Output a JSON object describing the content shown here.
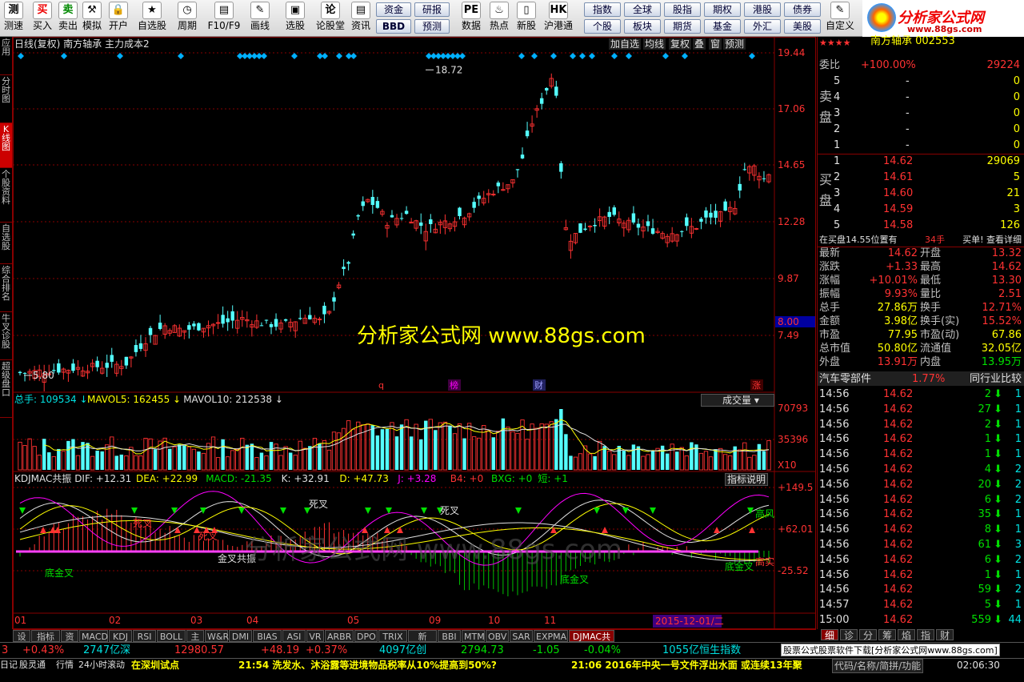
{
  "toolbar": {
    "buttons": [
      {
        "label": "测速",
        "icon": "测"
      },
      {
        "label": "买入",
        "icon": "买"
      },
      {
        "label": "卖出",
        "icon": "卖"
      },
      {
        "label": "模拟",
        "icon": "⚒"
      },
      {
        "label": "开户",
        "icon": "🔒"
      },
      {
        "label": "自选股",
        "icon": "★"
      },
      {
        "label": "周期",
        "icon": "◷"
      },
      {
        "label": "F10/F9",
        "icon": "▤"
      },
      {
        "label": "画线",
        "icon": "✎"
      },
      {
        "label": "选股",
        "icon": "▣"
      },
      {
        "label": "论股堂",
        "icon": "论"
      },
      {
        "label": "资讯",
        "icon": "▤"
      },
      {
        "label": "数据",
        "icon": "PE"
      },
      {
        "label": "热点",
        "icon": "♨"
      },
      {
        "label": "新股",
        "icon": "▯"
      },
      {
        "label": "沪港通",
        "icon": "HK"
      },
      {
        "label": "自定义",
        "icon": "✎"
      }
    ],
    "small_buttons": [
      "资金",
      "研报",
      "BBD",
      "预测",
      "指数",
      "全球",
      "股指",
      "期权",
      "港股",
      "债券",
      "个股",
      "板块",
      "期货",
      "基金",
      "外汇",
      "美股"
    ]
  },
  "logo": {
    "title": "分析家公式网",
    "url": "www.88gs.com"
  },
  "left_nav": [
    "应用",
    "分时图",
    "K线图",
    "个股资料",
    "自选股",
    "综合排名",
    "牛叉诊股",
    "超级盘口"
  ],
  "chart_header": {
    "title": "日线(复权)  南方轴承  主力成本2",
    "buttons": [
      "加自选",
      "均线",
      "复权",
      "叠",
      "窗",
      "预测"
    ],
    "price_labels": [
      "19.44",
      "17.06",
      "14.65",
      "12.28",
      "9.87",
      "8.00",
      "7.49"
    ],
    "max_label": "18.72",
    "min_label": "5.80",
    "watermark": "分析家公式网 www.88gs.com",
    "markers": [
      "q",
      "榜",
      "财",
      "涨"
    ],
    "watermark_dim": "分析家公式网 www.88gs.com"
  },
  "volume_header": {
    "items": [
      {
        "text": "总手: 109534",
        "color": "#00e0e0"
      },
      {
        "text": "MAVOL5: 162455",
        "color": "#ffff00"
      },
      {
        "text": "MAVOL10: 212538",
        "color": "#e0e0e0"
      }
    ],
    "dropdown": "成交量",
    "labels": [
      "70793",
      "35396",
      "X10"
    ]
  },
  "indicator_header": {
    "items": [
      {
        "text": "KDJMAC共振 DIF: +12.31",
        "color": "#e0e0e0"
      },
      {
        "text": "DEA: +22.99",
        "color": "#ffff00"
      },
      {
        "text": "MACD: -21.35",
        "color": "#00e000"
      },
      {
        "text": "K: +32.91",
        "color": "#e0e0e0"
      },
      {
        "text": "D: +47.73",
        "color": "#ffff00"
      },
      {
        "text": "J: +3.28",
        "color": "#ff00ff"
      },
      {
        "text": "B4: +0",
        "color": "#ff3232"
      },
      {
        "text": "BXG: +0",
        "color": "#00e000"
      },
      {
        "text": "短: +1",
        "color": "#00e000"
      }
    ],
    "explain_button": "指标说明",
    "labels": [
      "+149.5",
      "+62.01",
      "-25.52"
    ],
    "annotations": [
      "死叉",
      "死叉",
      "死叉",
      "死叉",
      "底金叉",
      "金叉共振",
      "底金叉",
      "底金叉",
      "高风",
      "高实"
    ]
  },
  "x_axis": {
    "months": [
      "01",
      "02",
      "03",
      "04",
      "05",
      "09",
      "10",
      "11"
    ],
    "current_date": "2015-12-01/二"
  },
  "tabs": [
    "设置",
    "指标平台",
    "资讯",
    "MACD",
    "KDJ",
    "RSI",
    "BOLL",
    "主力",
    "W&R",
    "DMI",
    "BIAS",
    "ASI",
    "VR",
    "ARBR",
    "DPO",
    "TRIX",
    "新DMA",
    "BBI",
    "MTM",
    "OBV",
    "SAR",
    "EXPMA",
    "DJMAC共振"
  ],
  "quote": {
    "header": "南方轴承 002553",
    "weibi": {
      "label": "委比",
      "pct": "+100.00%",
      "val": "29224"
    },
    "sell": [
      {
        "n": "5",
        "p": "-",
        "v": "0"
      },
      {
        "n": "4",
        "p": "-",
        "v": "0"
      },
      {
        "n": "3",
        "p": "-",
        "v": "0"
      },
      {
        "n": "2",
        "p": "-",
        "v": "0"
      },
      {
        "n": "1",
        "p": "-",
        "v": "0"
      }
    ],
    "sell_label": "卖盘",
    "buy": [
      {
        "n": "1",
        "p": "14.62",
        "v": "29069"
      },
      {
        "n": "2",
        "p": "14.61",
        "v": "5"
      },
      {
        "n": "3",
        "p": "14.60",
        "v": "21"
      },
      {
        "n": "4",
        "p": "14.59",
        "v": "3"
      },
      {
        "n": "5",
        "p": "14.58",
        "v": "126"
      }
    ],
    "buy_label": "买盘",
    "info_line": {
      "text": "在买盘14.55位置有",
      "qty": "34手",
      "btn": "买单! 查看详细"
    },
    "stats": [
      [
        "最新",
        "14.62",
        "开盘",
        "13.32"
      ],
      [
        "涨跌",
        "+1.33",
        "最高",
        "14.62"
      ],
      [
        "涨幅",
        "+10.01%",
        "最低",
        "13.30"
      ],
      [
        "振幅",
        "9.93%",
        "量比",
        "2.51"
      ],
      [
        "总手",
        "27.86万",
        "换手",
        "12.71%"
      ],
      [
        "金额",
        "3.98亿",
        "换手(实)",
        "15.52%"
      ],
      [
        "市盈",
        "77.95",
        "市盈(动)",
        "67.86"
      ],
      [
        "总市值",
        "50.80亿",
        "流通值",
        "32.05亿"
      ],
      [
        "外盘",
        "13.91万",
        "内盘",
        "13.95万"
      ]
    ],
    "industry": {
      "name": "汽车零部件",
      "pct": "1.77%",
      "btn": "同行业比较"
    },
    "ticks": [
      {
        "t": "14:56",
        "p": "14.62",
        "v": "2",
        "n": "1"
      },
      {
        "t": "14:56",
        "p": "14.62",
        "v": "27",
        "n": "1"
      },
      {
        "t": "14:56",
        "p": "14.62",
        "v": "2",
        "n": "1"
      },
      {
        "t": "14:56",
        "p": "14.62",
        "v": "1",
        "n": "1"
      },
      {
        "t": "14:56",
        "p": "14.62",
        "v": "1",
        "n": "1"
      },
      {
        "t": "14:56",
        "p": "14.62",
        "v": "4",
        "n": "2"
      },
      {
        "t": "14:56",
        "p": "14.62",
        "v": "20",
        "n": "2"
      },
      {
        "t": "14:56",
        "p": "14.62",
        "v": "6",
        "n": "2"
      },
      {
        "t": "14:56",
        "p": "14.62",
        "v": "35",
        "n": "1"
      },
      {
        "t": "14:56",
        "p": "14.62",
        "v": "8",
        "n": "1"
      },
      {
        "t": "14:56",
        "p": "14.62",
        "v": "61",
        "n": "3"
      },
      {
        "t": "14:56",
        "p": "14.62",
        "v": "6",
        "n": "2"
      },
      {
        "t": "14:56",
        "p": "14.62",
        "v": "1",
        "n": "1"
      },
      {
        "t": "14:56",
        "p": "14.62",
        "v": "59",
        "n": "2"
      },
      {
        "t": "14:57",
        "p": "14.62",
        "v": "5",
        "n": "1"
      },
      {
        "t": "15:00",
        "p": "14.62",
        "v": "559",
        "n": "44"
      }
    ],
    "bottom_tabs": [
      "细",
      "诊",
      "分",
      "筹",
      "焰",
      "指",
      "财"
    ]
  },
  "status1": {
    "items": [
      {
        "text": "3",
        "color": "#ff3232"
      },
      {
        "text": "+0.43%",
        "color": "#ff3232"
      },
      {
        "text": "2747亿深",
        "color": "#00e0e0"
      },
      {
        "text": "12980.57",
        "color": "#ff3232"
      },
      {
        "text": "+48.19",
        "color": "#ff3232"
      },
      {
        "text": "+0.37%",
        "color": "#ff3232"
      },
      {
        "text": "4097亿创",
        "color": "#00e0e0"
      },
      {
        "text": "2794.73",
        "color": "#00e000"
      },
      {
        "text": "-1.05",
        "color": "#00e000"
      },
      {
        "text": "-0.04%",
        "color": "#00e000"
      },
      {
        "text": "1055亿恒生指数",
        "color": "#00e0e0"
      }
    ],
    "banner": "股票公式股票软件下载[分析家公式网www.88gs.com]"
  },
  "status2": {
    "items": [
      "日记",
      "股灵通",
      "行情",
      "24小时滚动"
    ],
    "news": [
      "在深圳试点",
      "21:54 洗发水、沐浴露等进境物品税率从10%提高到50%?",
      "21:06 2016年中央一号文件浮出水面 或连续13年聚"
    ],
    "right": "代码/名称/简拼/功能",
    "time": "02:06:30"
  }
}
